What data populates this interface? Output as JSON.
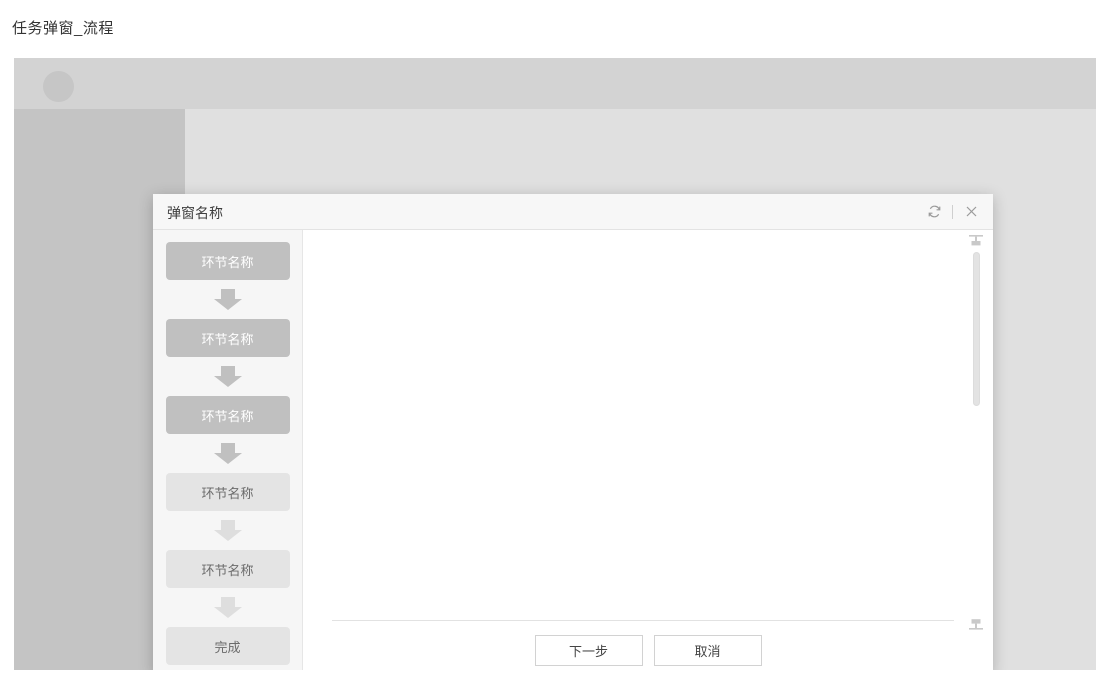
{
  "page": {
    "title": "任务弹窗_流程"
  },
  "app": {
    "avatar_label": "avatar-placeholder"
  },
  "dialog": {
    "title": "弹窗名称",
    "header_actions": [
      {
        "name": "refresh-icon",
        "label": "刷新"
      },
      {
        "name": "close-icon",
        "label": "关闭"
      }
    ],
    "steps": [
      {
        "label": "环节名称",
        "state": "active"
      },
      {
        "label": "环节名称",
        "state": "active"
      },
      {
        "label": "环节名称",
        "state": "active"
      },
      {
        "label": "环节名称",
        "state": "inactive"
      },
      {
        "label": "环节名称",
        "state": "inactive"
      },
      {
        "label": "完成",
        "state": "inactive"
      }
    ],
    "footer": {
      "primary_label": "下一步",
      "secondary_label": "取消"
    },
    "scroll": {
      "top_handle": "scroll-top-handle",
      "bottom_handle": "scroll-bottom-handle"
    }
  },
  "colors": {
    "step_active_bg": "#c0c0c0",
    "step_inactive_bg": "#e4e4e4",
    "arrow_active": "#c0c0c0",
    "arrow_inactive": "#dedede",
    "rail_bg": "#f6f6f6",
    "header_bg": "#f7f7f7",
    "app_topbar": "#d3d3d3",
    "app_sidebar": "#c4c4c4",
    "app_content": "#e0e0e0"
  }
}
